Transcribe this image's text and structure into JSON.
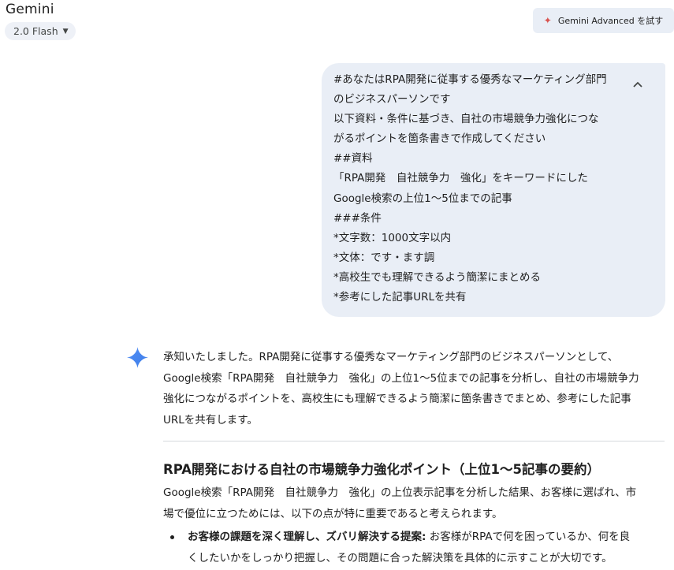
{
  "app": {
    "title": "Gemini",
    "model_label": "2.0 Flash",
    "advanced_label": "Gemini Advanced を試す"
  },
  "icons": {
    "model_caret": "chevron-down-icon",
    "advanced": "sparkle-icon",
    "collapse": "chevron-up-icon",
    "gemini": "gemini-sparkle-icon"
  },
  "colors": {
    "bubble_bg": "#e9eef6",
    "gemini_blue": "#4285f4",
    "advanced_spark": "#d9534f"
  },
  "prompt": {
    "lines": [
      "#あなたはRPA開発に従事する優秀なマーケティング部門",
      "のビジネスパーソンです",
      "以下資料・条件に基づき、自社の市場競争力強化につな",
      "がるポイントを箇条書きで作成してください",
      "##資料",
      "「RPA開発　自社競争力　強化」をキーワードにした",
      "Google検索の上位1〜5位までの記事",
      "###条件",
      "*文字数：1000文字以内",
      "*文体：です・ます調",
      "*高校生でも理解できるよう簡潔にまとめる",
      "*参考にした記事URLを共有"
    ]
  },
  "response": {
    "intro_lines": [
      "承知いたしました。RPA開発に従事する優秀なマーケティング部門のビジネスパーソンとして、",
      "Google検索「RPA開発　自社競争力　強化」の上位1〜5位までの記事を分析し、自社の市場競争力",
      "強化につながるポイントを、高校生にも理解できるよう簡潔に箇条書きでまとめ、参考にした記事",
      "URLを共有します。"
    ],
    "heading": "RPA開発における自社の市場競争力強化ポイント（上位1〜5記事の要約）",
    "summary_lines": [
      "Google検索「RPA開発　自社競争力　強化」の上位表示記事を分析した結果、お客様に選ばれ、市",
      "場で優位に立つためには、以下の点が特に重要であると考えられます。"
    ],
    "bullets": [
      {
        "bold": "お客様の課題を深く理解し、ズバリ解決する提案:",
        "line1_rest": " お客様がRPAで何を困っているか、何を良",
        "line2": "くしたいかをしっかり把握し、その問題に合った解決策を具体的に示すことが大切です。"
      }
    ]
  }
}
